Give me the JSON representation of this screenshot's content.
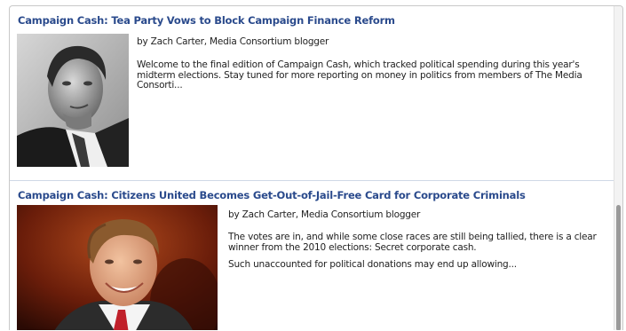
{
  "feed": {
    "entries": [
      {
        "title": "Campaign Cash: Tea Party Vows to Block Campaign Finance Reform",
        "byline": "by Zach Carter, Media Consortium blogger",
        "paragraphs": [
          "Welcome to the final edition of Campaign Cash, which tracked political spending during this year's midterm elections. Stay tuned for more reporting on money in politics from members of The Media Consorti..."
        ]
      },
      {
        "title": "Campaign Cash: Citizens United Becomes Get-Out-of-Jail-Free Card for Corporate Criminals",
        "byline": "by Zach Carter, Media Consortium blogger",
        "paragraphs": [
          "The votes are in, and while some close races are still being tallied, there is a clear winner from the 2010 elections: Secret corporate cash.",
          "Such unaccounted for political donations may end up allowing..."
        ]
      }
    ]
  }
}
